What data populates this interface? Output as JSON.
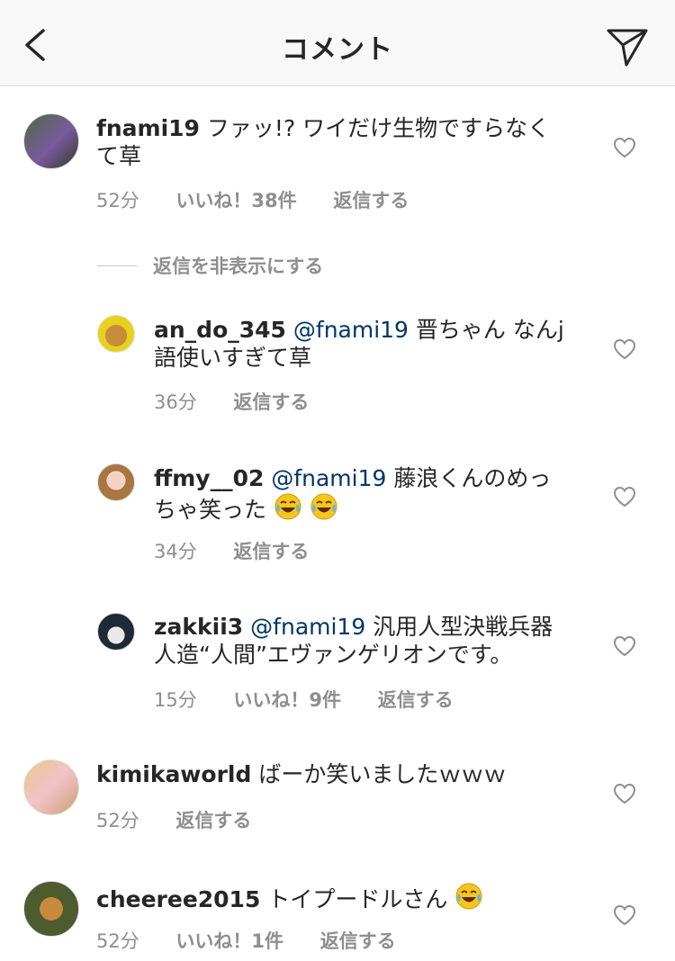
{
  "header": {
    "title": "コメント",
    "back_icon": "chevron-left-icon",
    "send_icon": "paper-plane-icon"
  },
  "hide_replies_label": "返信を非表示にする",
  "comments": [
    {
      "username": "fnami19",
      "mention": "",
      "text": "ファッ!? ワイだけ生物ですらなくて草",
      "time": "52分",
      "likes": "いいね！38件",
      "reply": "返信する",
      "emoji_count": 0
    },
    {
      "username": "an_do_345",
      "mention": "@fnami19",
      "text": "晋ちゃん なんj語使いすぎて草",
      "time": "36分",
      "likes": "",
      "reply": "返信する",
      "emoji_count": 0
    },
    {
      "username": "ffmy__02",
      "mention": "@fnami19",
      "text": "藤浪くんのめっちゃ笑った",
      "time": "34分",
      "likes": "",
      "reply": "返信する",
      "emoji_count": 2
    },
    {
      "username": "zakkii3",
      "mention": "@fnami19",
      "text": "汎用人型決戦兵器人造“人間”エヴァンゲリオンです。",
      "time": "15分",
      "likes": "いいね！9件",
      "reply": "返信する",
      "emoji_count": 0
    },
    {
      "username": "kimikaworld",
      "mention": "",
      "text": "ばーか笑いましたｗｗｗ",
      "time": "52分",
      "likes": "",
      "reply": "返信する",
      "emoji_count": 0
    },
    {
      "username": "cheeree2015",
      "mention": "",
      "text": "トイプードルさん",
      "time": "52分",
      "likes": "いいね！1件",
      "reply": "返信する",
      "emoji_count": 1
    }
  ]
}
